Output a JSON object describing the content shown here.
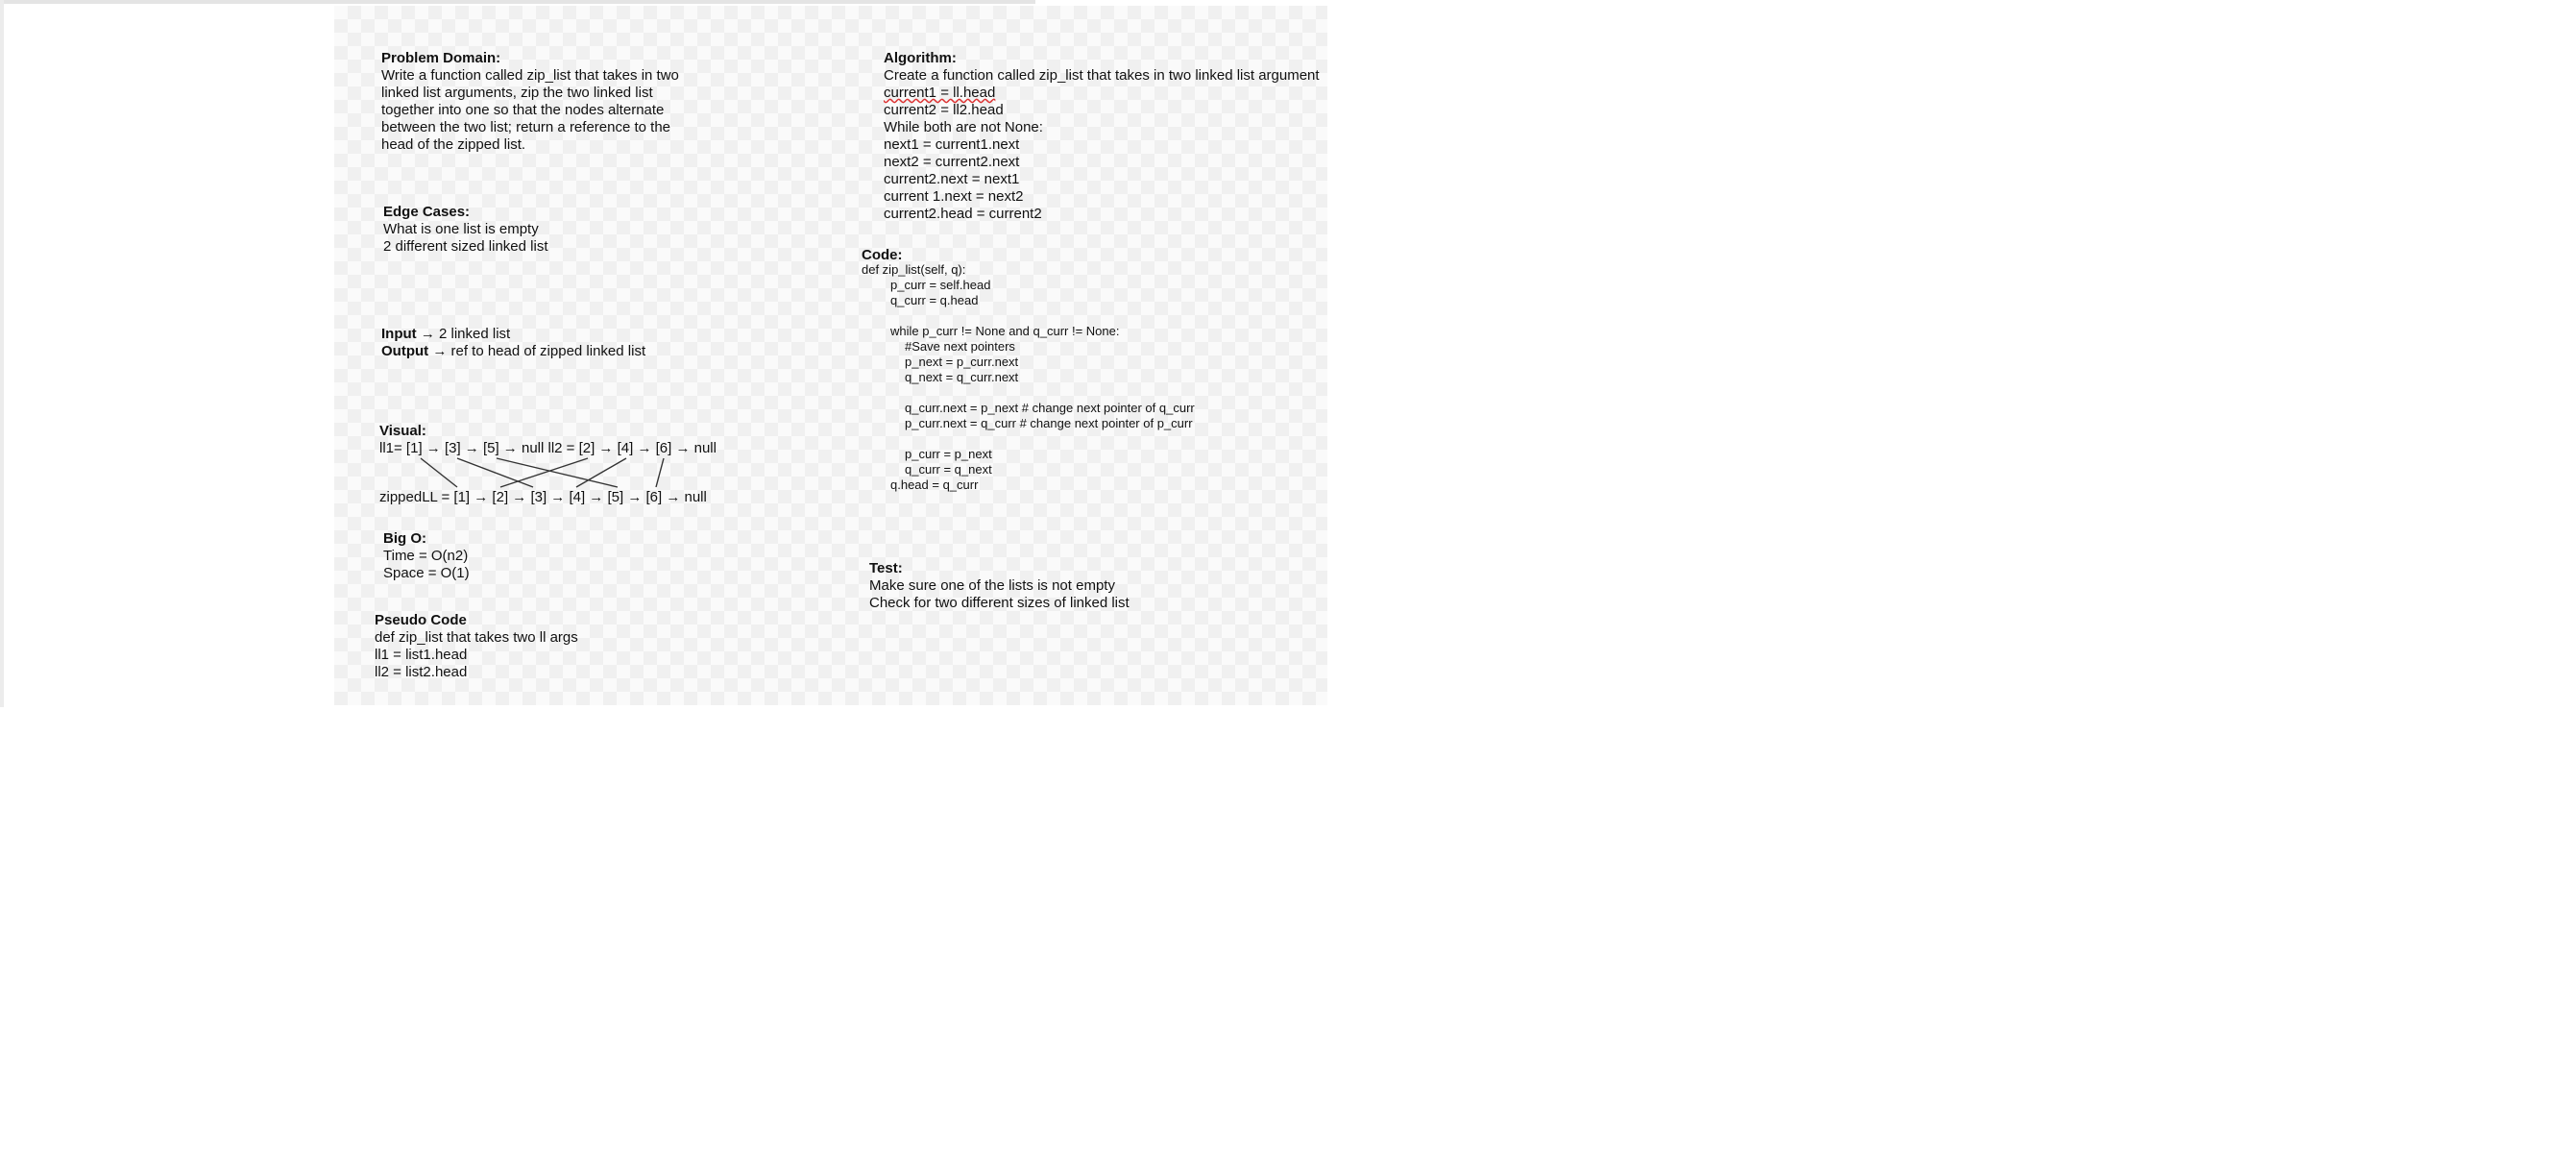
{
  "problem": {
    "title": "Problem Domain:",
    "lines": [
      "Write a function called zip_list that takes in two",
      "linked list arguments, zip the two linked list",
      "together into one so that the nodes alternate",
      "between the two list; return a reference to the",
      "head of the zipped list."
    ]
  },
  "edge": {
    "title": "Edge Cases:",
    "lines": [
      "What is one list is empty",
      "2 different sized linked list"
    ]
  },
  "io": {
    "input_label": "Input",
    "input_text": " → 2 linked list",
    "output_label": "Output",
    "output_text": " → ref to head of zipped linked list"
  },
  "visual": {
    "title": "Visual:",
    "line1": "ll1= [1] → [3] → [5] → null ll2 = [2] → [4] → [6] → null",
    "line2": "zippedLL = [1] → [2] → [3] → [4] → [5] → [6] → null"
  },
  "bigo": {
    "title": "Big O:",
    "lines": [
      "Time = O(n2)",
      "Space = O(1)"
    ]
  },
  "pseudo": {
    "title": "Pseudo Code",
    "lines": [
      "def zip_list that takes two ll args",
      "ll1 = list1.head",
      "ll2 = list2.head"
    ]
  },
  "algorithm": {
    "title": "Algorithm:",
    "lines": [
      "Create a function called zip_list that takes in two linked list argument",
      "current1 = ll.head",
      "current2 = ll2.head",
      "While both are not None:",
      "next1 = current1.next",
      "next2 = current2.next",
      "current2.next = next1",
      "current 1.next = next2",
      "current2.head = current2"
    ]
  },
  "code": {
    "title": "Code:",
    "lines": [
      "def zip_list(self, q):",
      "p_curr = self.head",
      "q_curr = q.head",
      "",
      "while p_curr != None and q_curr != None:",
      "#Save next pointers",
      "p_next = p_curr.next",
      "q_next = q_curr.next",
      "",
      "q_curr.next = p_next # change next pointer of q_curr",
      "p_curr.next = q_curr # change next pointer of p_curr",
      "",
      "p_curr = p_next",
      "q_curr = q_next",
      "q.head = q_curr"
    ]
  },
  "test": {
    "title": "Test:",
    "lines": [
      "Make sure one of the lists is not empty",
      "Check for two different sizes of linked list"
    ]
  }
}
